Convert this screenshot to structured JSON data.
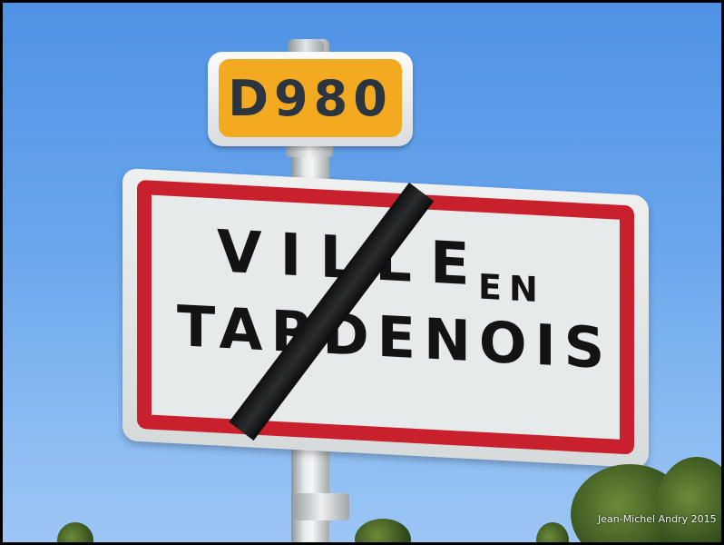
{
  "route_sign": {
    "text": "D980",
    "background": "#f3a920",
    "text_color": "#2b3540"
  },
  "town_sign": {
    "line1": "VILLE",
    "line2": "EN",
    "line3": "TARDENOIS",
    "border_color": "#c8202d",
    "crossed_out": true
  },
  "credit": {
    "text": "Jean-Michel Andry 2015"
  },
  "scene": {
    "sky_color": "#6aa6ec"
  }
}
